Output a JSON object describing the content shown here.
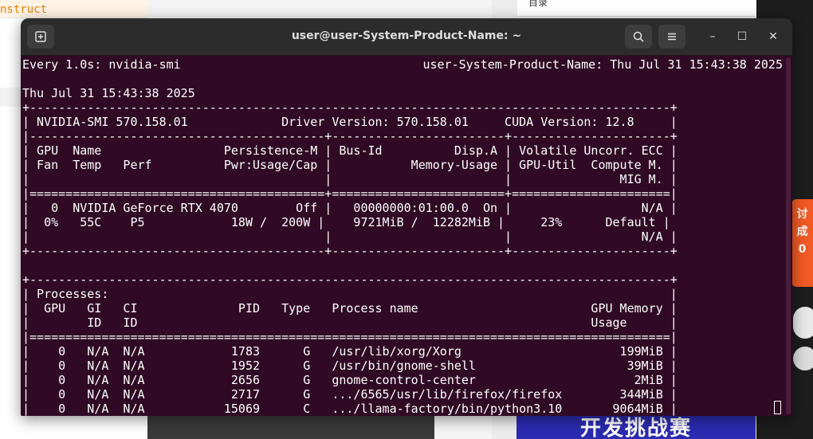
{
  "background": {
    "editor_text": "nstruct",
    "right_panel_text": "目录",
    "badge_text": "讨\n成\n0",
    "banner_text": "开发挑战赛"
  },
  "window": {
    "title": "user@user-System-Product-Name: ~",
    "new_tab_icon": "new-tab-icon",
    "search_icon": "search-icon",
    "menu_icon": "hamburger-menu-icon",
    "minimize_glyph": "–",
    "maximize_glyph": "☐",
    "close_glyph": "✕"
  },
  "terminal": {
    "header_left": "Every 1.0s: nvidia-smi",
    "header_right": "user-System-Product-Name: Thu Jul 31 15:43:38 2025",
    "body": "\nThu Jul 31 15:43:38 2025\n+-----------------------------------------------------------------------------------------+\n| NVIDIA-SMI 570.158.01             Driver Version: 570.158.01     CUDA Version: 12.8     |\n|-----------------------------------------+------------------------+----------------------+\n| GPU  Name                 Persistence-M | Bus-Id          Disp.A | Volatile Uncorr. ECC |\n| Fan  Temp   Perf          Pwr:Usage/Cap |           Memory-Usage | GPU-Util  Compute M. |\n|                                         |                        |               MIG M. |\n|=========================================+========================+======================|\n|   0  NVIDIA GeForce RTX 4070        Off |   00000000:01:00.0  On |                  N/A |\n|  0%   55C    P5            18W /  200W |    9721MiB /  12282MiB |     23%      Default |\n|                                         |                        |                  N/A |\n+-----------------------------------------+------------------------+----------------------+\n\n+-----------------------------------------------------------------------------------------+\n| Processes:                                                                              |\n|  GPU   GI   CI              PID   Type   Process name                        GPU Memory |\n|        ID   ID                                                               Usage      |\n|=========================================================================================|\n|    0   N/A  N/A            1783      G   /usr/lib/xorg/Xorg                      199MiB |\n|    0   N/A  N/A            1952      G   /usr/bin/gnome-shell                     39MiB |\n|    0   N/A  N/A            2656      G   gnome-control-center                      2MiB |\n|    0   N/A  N/A            2717      G   .../6565/usr/lib/firefox/firefox        344MiB |\n|    0   N/A  N/A           15069      C   .../llama-factory/bin/python3.10       9064MiB |"
  }
}
